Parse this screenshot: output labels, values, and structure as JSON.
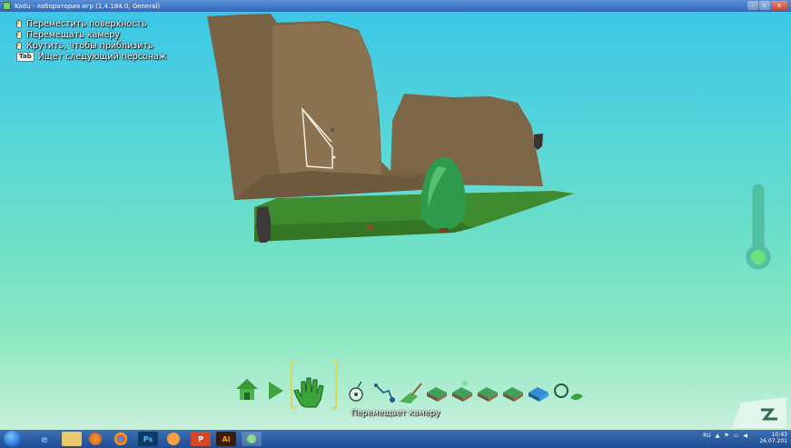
{
  "window": {
    "title": "Kodu - лаборатория игр (1.4.184.0, General)",
    "controls": [
      "–",
      "▫",
      "x"
    ]
  },
  "hints": [
    {
      "icon": "mouse-left-icon",
      "text": "Переместить поверхность"
    },
    {
      "icon": "mouse-left-icon",
      "text": "Перемещать камеру"
    },
    {
      "icon": "mouse-wheel-icon",
      "text": "Крутить, чтобы приблизить"
    },
    {
      "icon": "tab-key-icon",
      "key": "Tab",
      "text": "Ищет следующий персонаж"
    }
  ],
  "toolbar": {
    "caption": "Перемещает камеру",
    "tools": [
      {
        "name": "home-menu",
        "icon": "home-icon"
      },
      {
        "name": "play",
        "icon": "play-icon"
      },
      {
        "name": "move-camera",
        "icon": "hand-icon",
        "selected": true
      },
      {
        "name": "object-tool",
        "icon": "kodu-icon"
      },
      {
        "name": "path-tool",
        "icon": "path-icon"
      },
      {
        "name": "paint-terrain",
        "icon": "brush-icon"
      },
      {
        "name": "raise-lower-terrain",
        "icon": "terrain-raise-icon"
      },
      {
        "name": "smooth-terrain",
        "icon": "terrain-smooth-icon"
      },
      {
        "name": "roughen-terrain",
        "icon": "terrain-rough-icon"
      },
      {
        "name": "water-tool",
        "icon": "water-icon"
      },
      {
        "name": "erase-tool",
        "icon": "eraser-icon"
      },
      {
        "name": "world-settings",
        "icon": "settings-icon"
      }
    ]
  },
  "taskbar": {
    "buttons": [
      {
        "icon": "ie-icon",
        "label": "e"
      },
      {
        "icon": "explorer-icon",
        "label": ""
      },
      {
        "icon": "media-player-icon",
        "label": ""
      },
      {
        "icon": "chrome-icon",
        "label": ""
      },
      {
        "icon": "photoshop-icon",
        "label": "Ps"
      },
      {
        "icon": "paint-icon",
        "label": ""
      },
      {
        "icon": "powerpoint-icon",
        "label": "P"
      },
      {
        "icon": "illustrator-icon",
        "label": "Ai"
      },
      {
        "icon": "kodu-taskbar-icon",
        "label": ""
      }
    ],
    "language": "RU",
    "time": "10:43",
    "date": "26.07.201"
  },
  "colors": {
    "sky_top": "#3bc7e6",
    "sky_bottom": "#c8f0dc",
    "terrain": "#7d6647",
    "grass": "#3f8b2f",
    "tree": "#2e9a4c",
    "selection_bracket": "#d9d85a"
  }
}
